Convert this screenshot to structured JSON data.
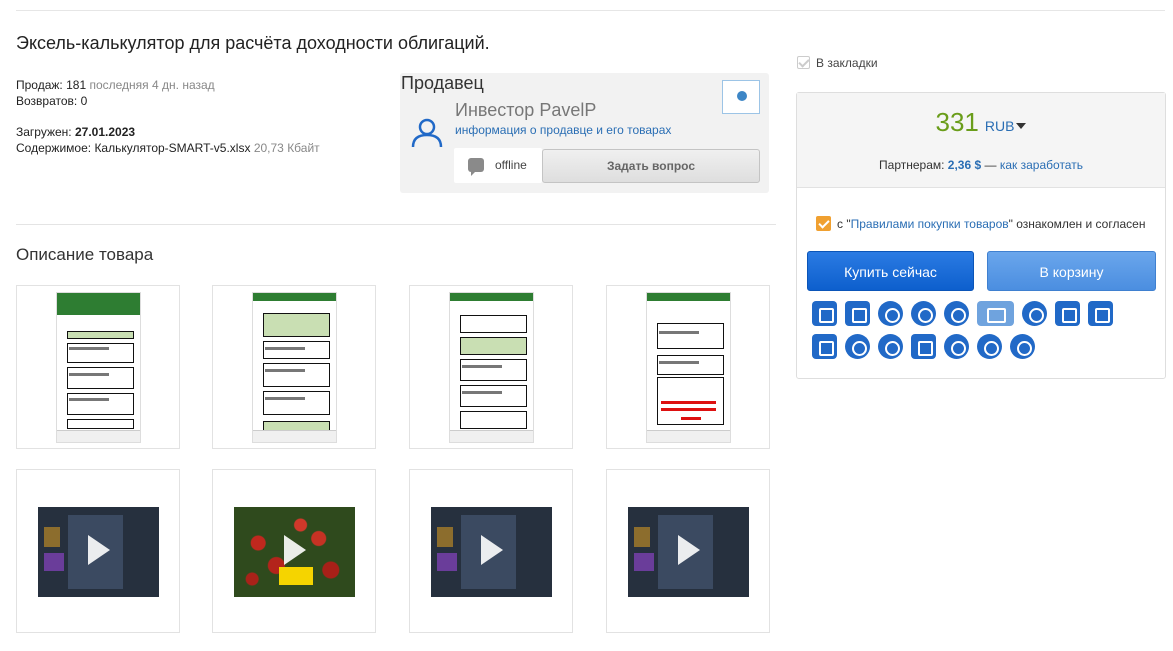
{
  "product": {
    "title": "Эксель-калькулятор для расчёта доходности облигаций."
  },
  "stats": {
    "sales_label": "Продаж:",
    "sales_count": "181",
    "last_sale": "последняя 4 дн. назад",
    "returns_label": "Возвратов:",
    "returns_count": "0",
    "uploaded_label": "Загружен:",
    "uploaded_date": "27.01.2023",
    "content_label": "Содержимое:",
    "content_file": "Калькулятор-SMART-v5.xlsx",
    "content_size": "20,73 Кбайт"
  },
  "seller": {
    "heading": "Продавец",
    "name": "Инвестор PavelP",
    "info_link": "информация о продавце и его товарах",
    "status": "offline",
    "ask_button": "Задать вопрос"
  },
  "description": {
    "heading": "Описание товара"
  },
  "bookmark": {
    "label": "В закладки"
  },
  "purchase": {
    "price": "331",
    "currency": "RUB",
    "partner_label": "Партнерам:",
    "partner_amount": "2,36 $",
    "partner_sep": "—",
    "partner_link": "как заработать",
    "agree_prefix": "с \"",
    "agree_link": "Правилами покупки товаров",
    "agree_suffix": "\" ознакомлен и согласен",
    "buy_button": "Купить сейчас",
    "cart_button": "В корзину",
    "price_color": "#6a9d1a",
    "accent_color": "#2a6eb4"
  },
  "gallery": {
    "screenshots": [
      "spreadsheet-screenshot-1",
      "spreadsheet-screenshot-2",
      "spreadsheet-screenshot-3",
      "spreadsheet-screenshot-4"
    ],
    "videos": [
      "video-preview-1",
      "video-preview-2",
      "video-preview-3",
      "video-preview-4"
    ]
  },
  "payment_icons": {
    "row1": [
      "bank-card-icon",
      "bank-card-alt-icon",
      "webmoney-icon",
      "qiwi-icon",
      "steam-icon",
      "unionpay-icon",
      "opay-icon",
      "diamond-icon",
      "sbp-icon"
    ],
    "row2": [
      "gift-icon",
      "bitcoin-icon",
      "litecoin-icon",
      "shopping-cart-icon",
      "tether-icon",
      "ethereum-icon",
      "webmoney-alt-icon"
    ]
  }
}
